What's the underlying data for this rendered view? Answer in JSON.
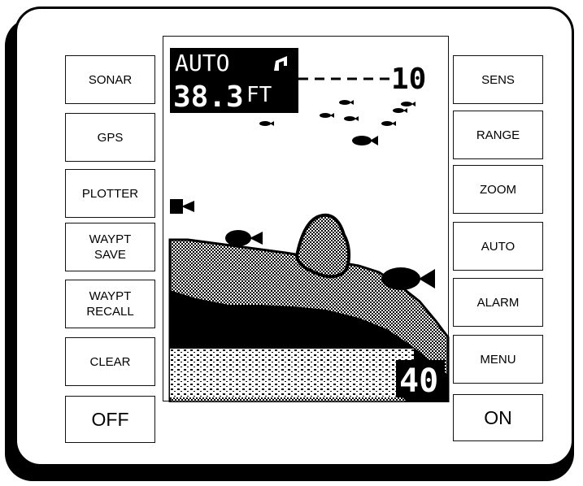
{
  "left_keys": [
    "SONAR",
    "GPS",
    "PLOTTER",
    "WAYPT\nSAVE",
    "WAYPT\nRECALL",
    "CLEAR"
  ],
  "off_key": "OFF",
  "right_keys": [
    "SENS",
    "RANGE",
    "ZOOM",
    "AUTO",
    "ALARM",
    "MENU"
  ],
  "on_key": "ON",
  "display": {
    "mode": "AUTO",
    "depth_value": "38.3",
    "depth_unit": "FT",
    "range_top": "10",
    "range_bottom": "40"
  }
}
